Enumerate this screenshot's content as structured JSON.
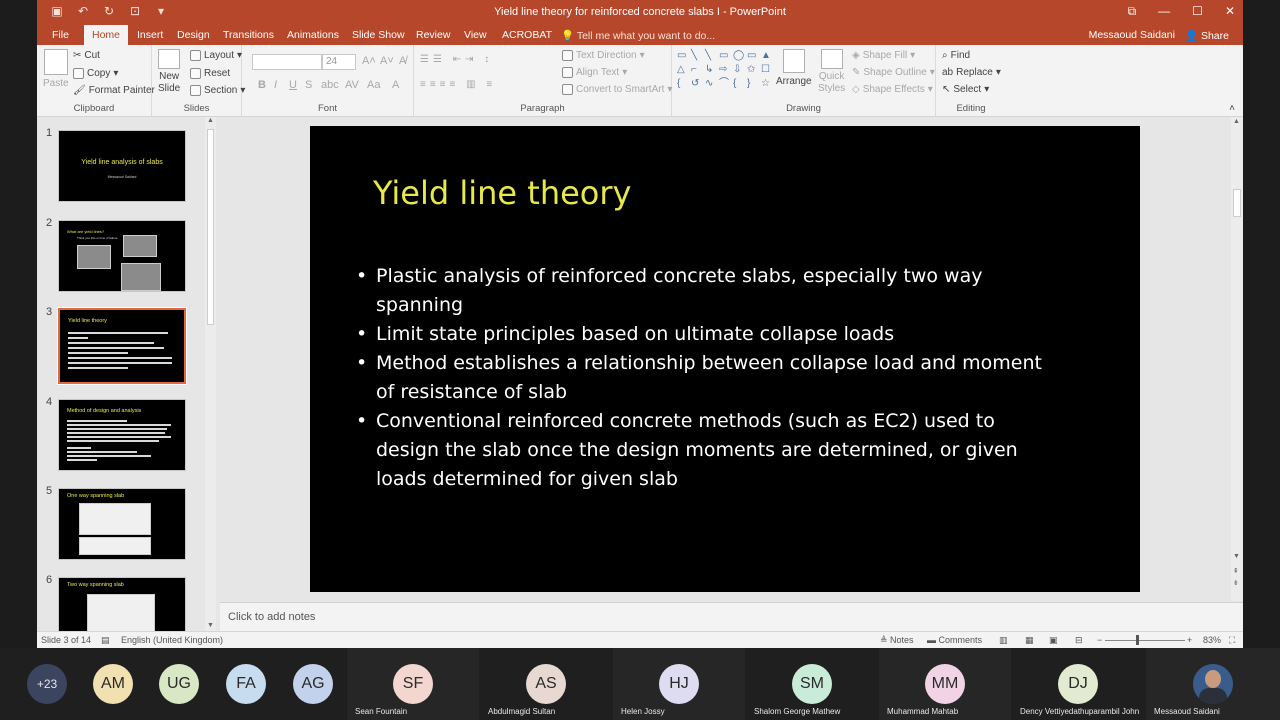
{
  "window": {
    "title": "Yield line theory for reinforced concrete slabs I - PowerPoint"
  },
  "tabs": [
    "File",
    "Home",
    "Insert",
    "Design",
    "Transitions",
    "Animations",
    "Slide Show",
    "Review",
    "View",
    "ACROBAT"
  ],
  "active_tab": "Home",
  "tell_me": "Tell me what you want to do...",
  "user_name": "Messaoud Saidani",
  "share_label": "Share",
  "ribbon": {
    "clipboard": {
      "paste": "Paste",
      "cut": "Cut",
      "copy": "Copy",
      "format_painter": "Format Painter",
      "group": "Clipboard"
    },
    "slides": {
      "new_slide_1": "New",
      "new_slide_2": "Slide",
      "layout": "Layout",
      "reset": "Reset",
      "section": "Section",
      "group": "Slides"
    },
    "font": {
      "size": "24",
      "group": "Font"
    },
    "paragraph": {
      "text_direction": "Text Direction",
      "align_text": "Align Text",
      "convert_smartart": "Convert to SmartArt",
      "group": "Paragraph"
    },
    "drawing": {
      "arrange": "Arrange",
      "quick_styles_1": "Quick",
      "quick_styles_2": "Styles",
      "shape_fill": "Shape Fill",
      "shape_outline": "Shape Outline",
      "shape_effects": "Shape Effects",
      "group": "Drawing"
    },
    "editing": {
      "find": "Find",
      "replace": "Replace",
      "select": "Select",
      "group": "Editing"
    }
  },
  "thumbnails": [
    {
      "num": "1",
      "title": "Yield line analysis of slabs",
      "subtitle": "Messaoud Saidani"
    },
    {
      "num": "2",
      "title": "What are yield lines?",
      "subtitle": "Think you this on line of failure"
    },
    {
      "num": "3",
      "title": "Yield line theory"
    },
    {
      "num": "4",
      "title": "Method of design and analysis"
    },
    {
      "num": "5",
      "title": "One way spanning slab"
    },
    {
      "num": "6",
      "title": "Two way spanning slab"
    }
  ],
  "slide": {
    "title": "Yield line theory",
    "bullets": [
      "Plastic analysis of reinforced concrete slabs, especially two way spanning",
      "Limit state principles based on ultimate collapse loads",
      "Method establishes a relationship between collapse load and moment of resistance of slab",
      "Conventional reinforced concrete methods (such as EC2) used to design the slab once the design moments are determined, or given loads determined for given slab"
    ]
  },
  "notes_placeholder": "Click to add notes",
  "status": {
    "slide_count": "Slide 3 of 14",
    "language": "English (United Kingdom)",
    "notes": "Notes",
    "comments": "Comments",
    "zoom": "83%"
  },
  "participants": {
    "overflow": "+23",
    "people": [
      {
        "initials": "AM",
        "name": "",
        "color": "#f1e0b0"
      },
      {
        "initials": "UG",
        "name": "",
        "color": "#d9e8c4"
      },
      {
        "initials": "FA",
        "name": "",
        "color": "#c8dcf0"
      },
      {
        "initials": "AG",
        "name": "",
        "color": "#c3d2ec"
      },
      {
        "initials": "SF",
        "name": "Sean Fountain",
        "color": "#f4d6d0"
      },
      {
        "initials": "AS",
        "name": "Abdulmagid Sultan",
        "color": "#e7d9d2"
      },
      {
        "initials": "HJ",
        "name": "Helen Jossy",
        "color": "#dedcf0"
      },
      {
        "initials": "SM",
        "name": "Shalom George Mathew",
        "color": "#c9ecd8"
      },
      {
        "initials": "MM",
        "name": "Muhammad Mahtab",
        "color": "#f2d3e6"
      },
      {
        "initials": "DJ",
        "name": "Dency Vettiyedathuparambil John",
        "color": "#e2ead2"
      },
      {
        "initials": "",
        "name": "Messaoud Saidani",
        "color": "#3a5c8a"
      }
    ]
  },
  "colors": {
    "accent": "#b7472a",
    "slide_title": "#e8e84a",
    "selection": "#e2683f"
  }
}
